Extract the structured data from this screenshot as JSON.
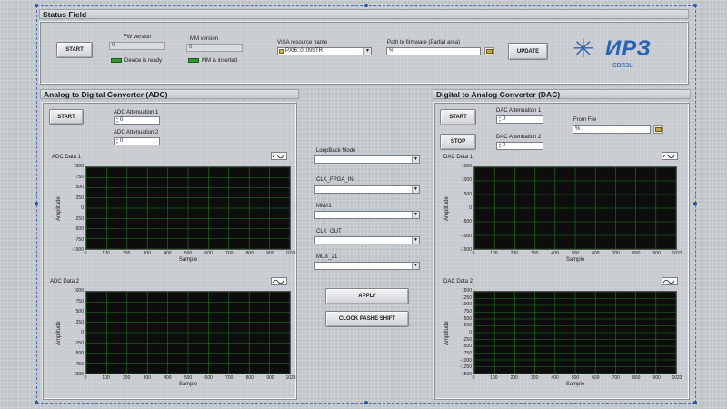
{
  "status": {
    "title": "Status Field",
    "start_label": "START",
    "fw_version_label": "FW version",
    "fw_version_value": "0",
    "device_ready_label": "Device is ready",
    "mm_version_label": "MM version",
    "mm_version_value": "0",
    "mm_inserted_label": "MM is inserted",
    "visa_label": "VISA resource name",
    "visa_value": "PXI6::0::INSTR",
    "path_label": "Path to firmware (Partial area)",
    "path_value": "",
    "update_label": "UPDATE",
    "logo_text": "ИРЗ",
    "logo_sub": "связь"
  },
  "adc": {
    "title": "Analog to Digital Converter (ADC)",
    "start_label": "START",
    "att1_label": "ADC Attenuation 1",
    "att1_value": "0",
    "att2_label": "ADC Attenuation 2",
    "att2_value": "0",
    "chart1_title": "ADC Data 1",
    "chart2_title": "ADC Data 2"
  },
  "dac": {
    "title": "Digital to Analog Converter (DAC)",
    "start_label": "START",
    "stop_label": "STOP",
    "att1_label": "DAC Attenuation 1",
    "att1_value": "0",
    "att2_label": "DAC Attenuation 2",
    "att2_value": "0",
    "from_file_label": "From File",
    "from_file_value": "",
    "chart1_title": "DAC Data 1",
    "chart2_title": "DAC Data 2"
  },
  "middle": {
    "loopback_label": "LoopBack Mode",
    "clk_fpga_label": "CLK_FPGA_IN",
    "mm1_label": "MM#1",
    "clk_out_label": "CLK_OUT",
    "mux_label": "MUX_21",
    "apply_label": "APPLY",
    "clock_phase_label": "CLOCK PASHE SHIFT"
  },
  "charts": {
    "x_label": "Sample",
    "y_label": "Amplitude",
    "x_ticks": [
      "0",
      "100",
      "200",
      "300",
      "400",
      "500",
      "600",
      "700",
      "800",
      "900",
      "1023"
    ],
    "adc_y_ticks": [
      "1000",
      "750",
      "500",
      "250",
      "0",
      "-250",
      "-500",
      "-750",
      "-1000"
    ],
    "dac_y_ticks": [
      "1500",
      "1000",
      "500",
      "0",
      "-500",
      "-1000",
      "-1500"
    ],
    "dac2_y_ticks": [
      "1500",
      "1250",
      "1000",
      "750",
      "500",
      "250",
      "0",
      "-250",
      "-500",
      "-750",
      "-1000",
      "-1250",
      "-1500"
    ],
    "grid_color": "#1f7a1f",
    "bg_color": "#0d0d0d"
  }
}
